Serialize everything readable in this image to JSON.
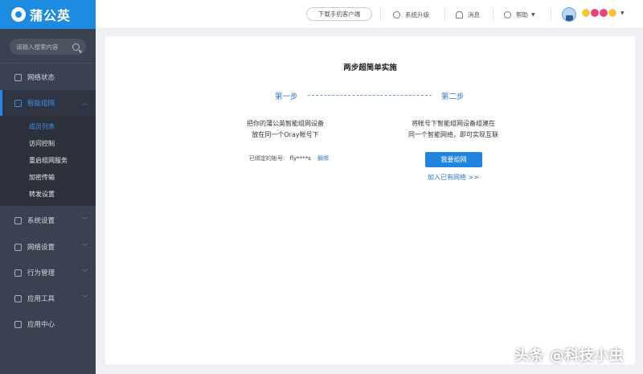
{
  "app": {
    "brand": "蒲公英"
  },
  "search": {
    "placeholder": "请输入搜索内容"
  },
  "sidebar": {
    "items": [
      {
        "label": "网络状态",
        "icon": "network-status-icon"
      },
      {
        "label": "智能组网",
        "icon": "smart-network-icon",
        "active": true
      },
      {
        "label": "系统设置",
        "icon": "settings-icon"
      },
      {
        "label": "网络设置",
        "icon": "network-settings-icon"
      },
      {
        "label": "行为管理",
        "icon": "behavior-icon"
      },
      {
        "label": "应用工具",
        "icon": "tools-icon"
      },
      {
        "label": "应用中心",
        "icon": "app-center-icon"
      }
    ],
    "subitems": [
      {
        "label": "成员列表",
        "current": true
      },
      {
        "label": "访问控制"
      },
      {
        "label": "重启组网服务"
      },
      {
        "label": "加密传输"
      },
      {
        "label": "转发设置"
      }
    ]
  },
  "topbar": {
    "download_label": "下载手机客户端",
    "upgrade_label": "系统升级",
    "messages_label": "消息",
    "help_label": "帮助",
    "username": "😶❤️❤️😶"
  },
  "main": {
    "title": "两步超简单实施",
    "step1_label": "第一步",
    "step2_label": "第二步",
    "step1_desc_line1": "把你的蒲公英智能组网设备",
    "step1_desc_line2": "放在同一个Oray帐号下",
    "step2_desc_line1": "将帐号下智能组网设备组建在",
    "step2_desc_line2": "同一个智能网络，即可实现互联",
    "bound_label": "已绑定的帐号:",
    "bound_account": "fly****s",
    "unbind_label": "解绑",
    "primary_button": "我要组网",
    "join_link": "加入已有网络 >>"
  },
  "watermark": "头条 @科技小虫",
  "colors": {
    "accent": "#2185e0",
    "sidebar": "#3a4150",
    "logo_bg": "#1d8ce0"
  }
}
